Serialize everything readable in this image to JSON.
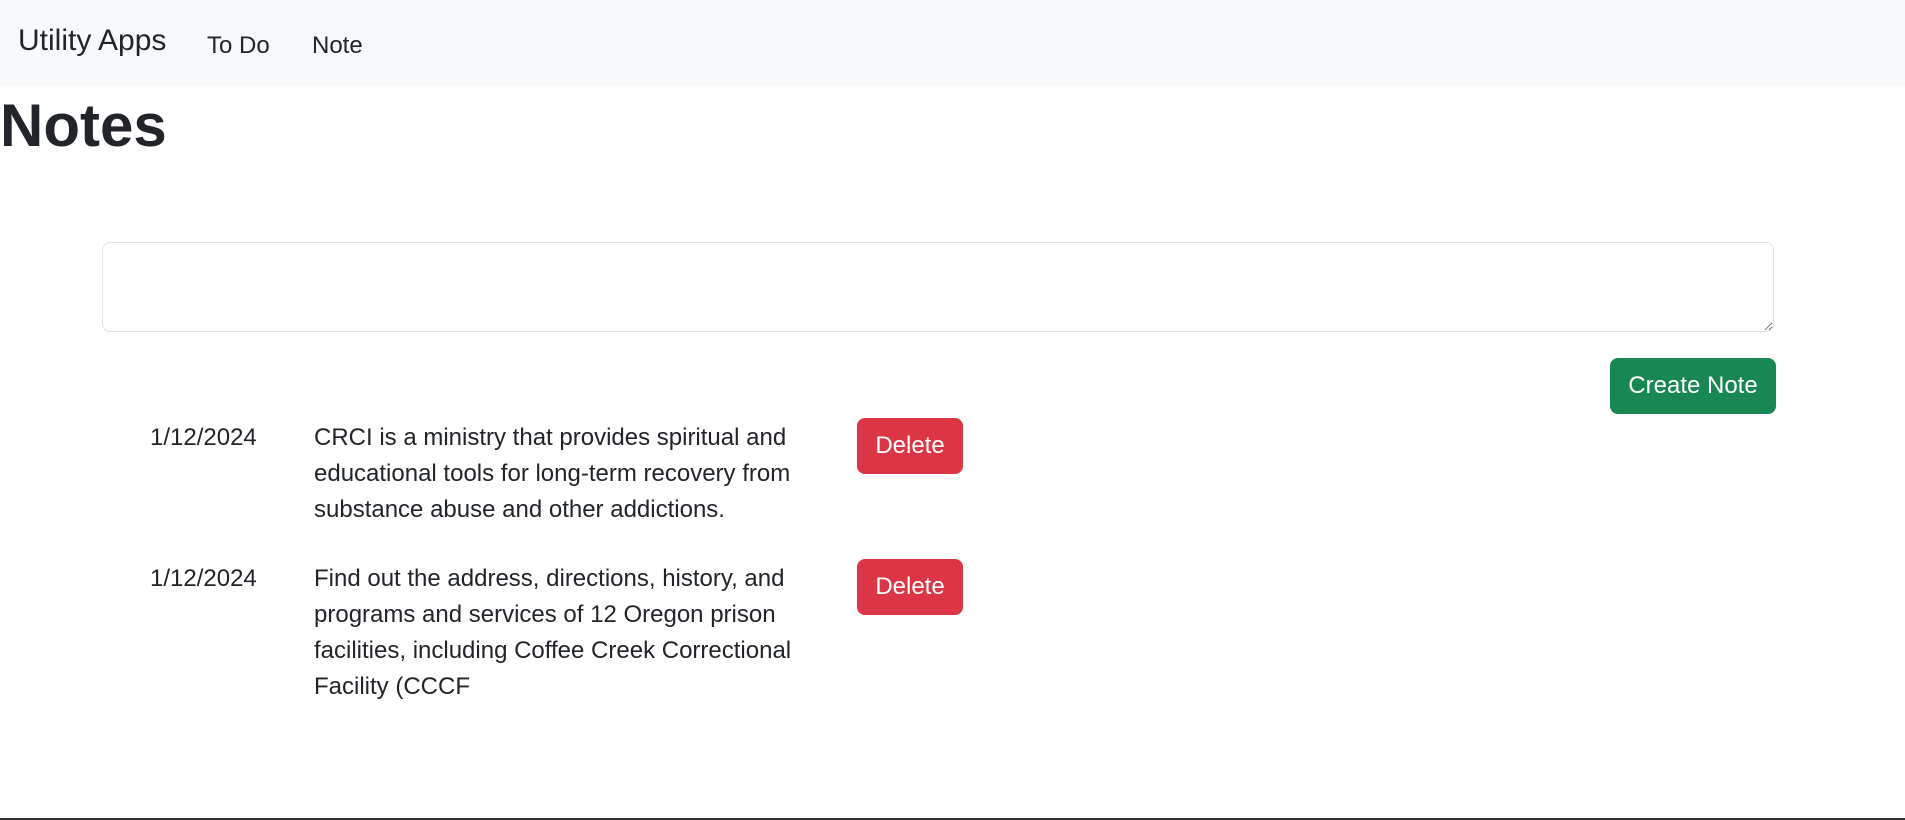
{
  "navbar": {
    "brand": "Utility Apps",
    "links": [
      {
        "label": "To Do"
      },
      {
        "label": "Note"
      }
    ]
  },
  "page": {
    "title": "Notes"
  },
  "composer": {
    "value": "",
    "placeholder": "",
    "create_label": "Create Note"
  },
  "notes": [
    {
      "date": "1/12/2024",
      "text": "CRCI is a ministry that provides spiritual and educational tools for long-term recovery from substance abuse and other addictions.",
      "delete_label": "Delete"
    },
    {
      "date": "1/12/2024",
      "text": "Find out the address, directions, history, and programs and services of 12 Oregon prison facilities, including Coffee Creek Correctional Facility (CCCF",
      "delete_label": "Delete"
    }
  ],
  "colors": {
    "navbar_bg": "#f8f9fa",
    "success": "#198754",
    "danger": "#dc3545",
    "text": "#212529"
  }
}
